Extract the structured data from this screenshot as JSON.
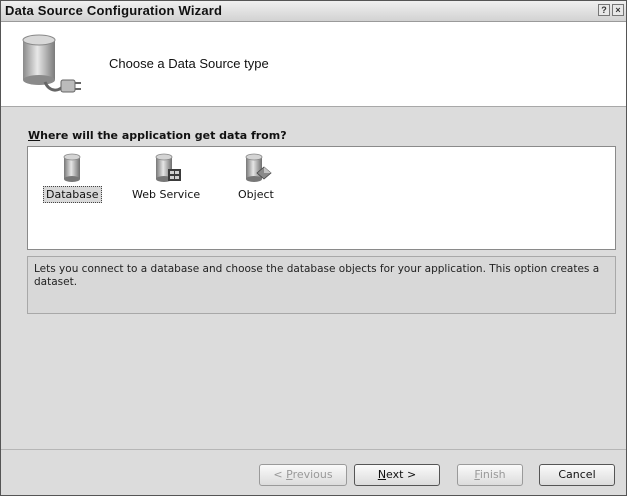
{
  "window": {
    "title": "Data Source Configuration Wizard",
    "help_glyph": "?",
    "close_glyph": "×"
  },
  "header": {
    "title": "Choose a Data Source type",
    "icon": "database-plug-icon"
  },
  "section": {
    "label_mnemonic": "W",
    "label_rest": "here will the application get data from?"
  },
  "types": [
    {
      "label": "Database",
      "icon": "database-icon",
      "selected": true
    },
    {
      "label": "Web Service",
      "icon": "web-service-icon",
      "selected": false
    },
    {
      "label": "Object",
      "icon": "object-icon",
      "selected": false
    }
  ],
  "description": "Lets you connect to a database and choose the database objects for your application. This option creates a dataset.",
  "buttons": {
    "previous": {
      "prefix": "< ",
      "mnemonic": "P",
      "rest": "revious",
      "enabled": false
    },
    "next": {
      "mnemonic": "N",
      "rest": "ext >",
      "enabled": true
    },
    "finish": {
      "mnemonic": "F",
      "rest": "inish",
      "enabled": false
    },
    "cancel": {
      "label": "Cancel",
      "enabled": true
    }
  }
}
